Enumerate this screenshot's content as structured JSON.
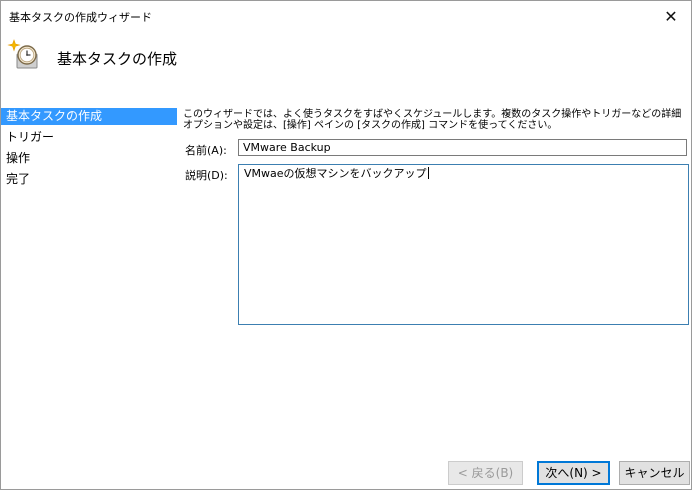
{
  "window": {
    "title": "基本タスクの作成ウィザード",
    "close_glyph": "✕"
  },
  "header": {
    "title": "基本タスクの作成",
    "icon": "task-scheduler-clock-icon"
  },
  "sidebar": {
    "items": [
      {
        "label": "基本タスクの作成",
        "active": true
      },
      {
        "label": "トリガー",
        "active": false
      },
      {
        "label": "操作",
        "active": false
      },
      {
        "label": "完了",
        "active": false
      }
    ]
  },
  "main": {
    "description": "このウィザードでは、よく使うタスクをすばやくスケジュールします。複数のタスク操作やトリガーなどの詳細オプションや設定は、[操作] ペインの [タスクの作成] コマンドを使ってください。",
    "name_label": "名前(A):",
    "name_value": "VMware Backup",
    "desc_label": "説明(D):",
    "desc_value": "VMwaeの仮想マシンをバックアップ"
  },
  "buttons": {
    "back": "< 戻る(B)",
    "next": "次へ(N) >",
    "cancel": "キャンセル"
  },
  "colors": {
    "selection": "#3399ff",
    "focus_border": "#3c7fb1",
    "default_button_border": "#0078d7"
  }
}
